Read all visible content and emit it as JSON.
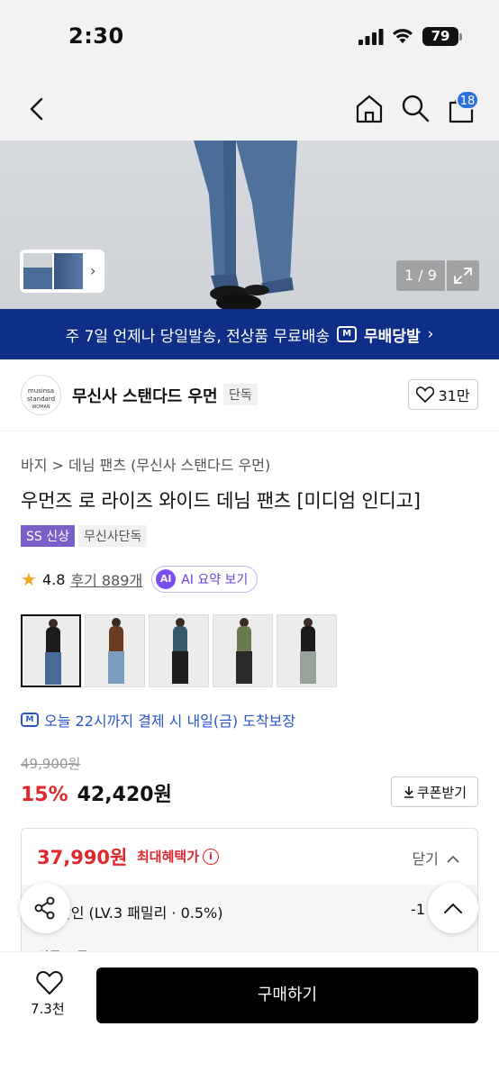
{
  "status": {
    "time": "2:30",
    "battery": "79"
  },
  "header": {
    "cart_count": "18"
  },
  "hero": {
    "counter": "1 / 9"
  },
  "banner": {
    "text": "주 7일 언제나 당일발송, 전상품 무료배송",
    "brand": "무배당발",
    "chevron": "›"
  },
  "brand": {
    "logo_line1": "musinsa",
    "logo_line2": "standard",
    "logo_line3": "WOMAN",
    "name": "무신사 스탠다드 우먼",
    "tag": "단독",
    "likes": "31만"
  },
  "product": {
    "breadcrumb": "바지 > 데님 팬츠 (무신사 스탠다드 우먼)",
    "title": "우먼즈 로 라이즈 와이드 데님 팬츠 [미디엄 인디고]",
    "tags": [
      "SS 신상",
      "무신사단독"
    ],
    "rating": "4.8",
    "reviews": "후기 889개",
    "ai_badge": "AI",
    "ai_label": "AI 요약 보기"
  },
  "color_options": [
    {
      "top": "#1c1c1c",
      "leg": "#4a6a96"
    },
    {
      "top": "#6b3b22",
      "leg": "#7c9cc0"
    },
    {
      "top": "#355966",
      "leg": "#1e1e1e"
    },
    {
      "top": "#6b7a4e",
      "leg": "#2a2a2a"
    },
    {
      "top": "#1a1a1a",
      "leg": "#97a39a"
    }
  ],
  "delivery": {
    "icon_text": "M",
    "text": "오늘 22시까지 결제 시 내일(금) 도착보장"
  },
  "pricing": {
    "original": "49,900원",
    "rate": "15%",
    "current": "42,420원",
    "coupon": "쿠폰받기"
  },
  "benefit": {
    "max_price": "37,990원",
    "max_label": "최대혜택가",
    "info": "i",
    "close": "닫기",
    "discount_label": "할인 (LV.3 패밀리 · 0.5%)",
    "discount_value": "-1",
    "cut_text": "상품 쿠폰"
  },
  "bottom": {
    "likes": "7.3천",
    "buy": "구매하기"
  },
  "colors": {
    "accent_blue": "#2b55c8",
    "sale_red": "#e0282e",
    "banner_navy": "#0f2e87"
  }
}
